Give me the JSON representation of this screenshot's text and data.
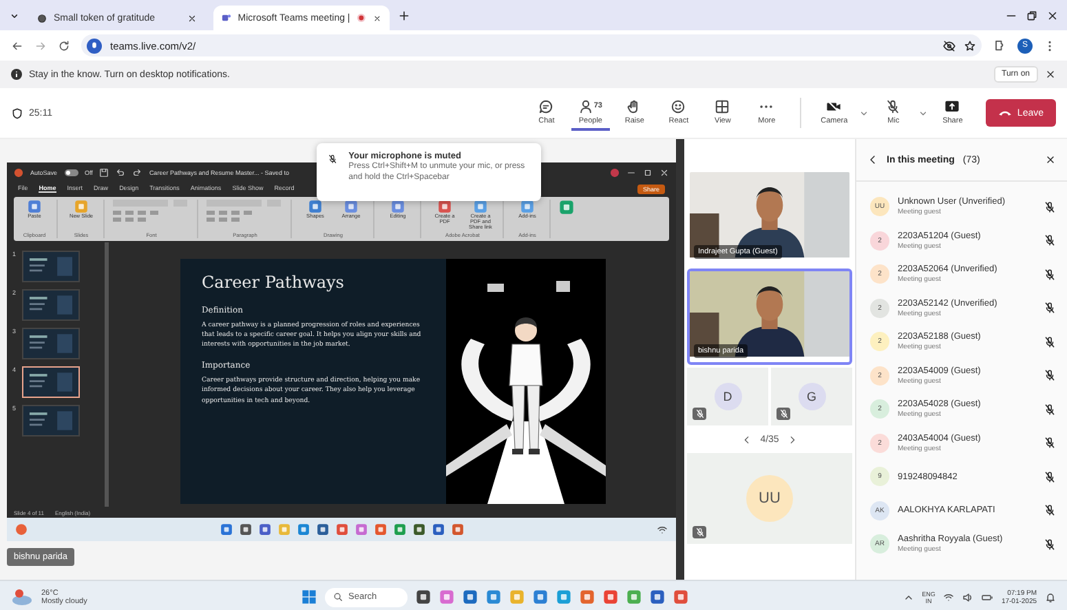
{
  "browser": {
    "tabs": [
      {
        "title": "Small token of gratitude",
        "selected": false
      },
      {
        "title": "Microsoft Teams meeting |",
        "selected": true
      }
    ],
    "url": "teams.live.com/v2/",
    "profile": "S"
  },
  "notification": {
    "text": "Stay in the know. Turn on desktop notifications.",
    "button": "Turn on"
  },
  "meeting": {
    "timer": "25:11",
    "toolbar": [
      {
        "kind": "chat",
        "label": "Chat",
        "selected": false
      },
      {
        "kind": "people",
        "label": "People",
        "count": "73",
        "selected": true
      },
      {
        "kind": "raise",
        "label": "Raise",
        "selected": false
      },
      {
        "kind": "react",
        "label": "React",
        "selected": false
      },
      {
        "kind": "view",
        "label": "View",
        "selected": false
      },
      {
        "kind": "more",
        "label": "More",
        "selected": false
      }
    ],
    "devices": [
      {
        "kind": "camera",
        "label": "Camera"
      },
      {
        "kind": "mic",
        "label": "Mic"
      },
      {
        "kind": "share",
        "label": "Share"
      }
    ],
    "leave": "Leave"
  },
  "toast": {
    "title": "Your microphone is muted",
    "text": "Press Ctrl+Shift+M to unmute your mic, or press and hold the Ctrl+Spacebar"
  },
  "shared_screen": {
    "ppt": {
      "autosave": "AutoSave",
      "autosave_on": false,
      "autosave_state": "Off",
      "title": "Career Pathways and Resume Master... - Saved to",
      "share": "Share",
      "ribbon_tabs": [
        {
          "label": "File",
          "selected": false
        },
        {
          "label": "Home",
          "selected": true
        },
        {
          "label": "Insert",
          "selected": false
        },
        {
          "label": "Draw",
          "selected": false
        },
        {
          "label": "Design",
          "selected": false
        },
        {
          "label": "Transitions",
          "selected": false
        },
        {
          "label": "Animations",
          "selected": false
        },
        {
          "label": "Slide Show",
          "selected": false
        },
        {
          "label": "Record",
          "selected": false
        }
      ],
      "ribbon_groups": [
        {
          "label": "Clipboard",
          "buttons": [
            "Paste"
          ]
        },
        {
          "label": "Slides",
          "buttons": [
            "New Slide"
          ]
        },
        {
          "label": "Font"
        },
        {
          "label": "Paragraph"
        },
        {
          "label": "Drawing",
          "buttons": [
            "Shapes",
            "Arrange"
          ]
        },
        {
          "buttons": [
            "Editing"
          ]
        },
        {
          "label": "Adobe Acrobat",
          "buttons": [
            "Create a PDF",
            "Create a PDF and Share link"
          ]
        },
        {
          "label": "Add-ins",
          "buttons": [
            "Add-ins"
          ]
        }
      ],
      "thumbnails": [
        {
          "number": "1",
          "selected": false
        },
        {
          "number": "2",
          "selected": false
        },
        {
          "number": "3",
          "selected": false
        },
        {
          "number": "4",
          "selected": true
        },
        {
          "number": "5",
          "selected": false
        }
      ],
      "slide": {
        "title": "Career Pathways",
        "sections": [
          {
            "heading": "Definition",
            "text": "A career pathway is a planned progression of roles and experiences that leads to a specific career goal. It helps you align your skills and interests with opportunities in the job market."
          },
          {
            "heading": "Importance",
            "text": "Career pathways provide structure and direction, helping you make informed decisions about your career. They also help you leverage opportunities in tech and beyond."
          }
        ]
      },
      "status": [
        "Slide 4 of 11",
        "English (India)"
      ]
    },
    "presenter": "bishnu parida"
  },
  "videos": [
    {
      "name": "Indrajeet Gupta (Guest)",
      "selected": false
    },
    {
      "name": "bishnu parida",
      "selected": true
    }
  ],
  "avatar_tiles": [
    {
      "initials": "D"
    },
    {
      "initials": "G"
    }
  ],
  "pager": "4/35",
  "large_tile": {
    "initials": "UU"
  },
  "people_panel": {
    "title": "In this meeting",
    "count": "(73)",
    "participants": [
      {
        "initials": "UU",
        "name": "Unknown User (Unverified)",
        "role": "Meeting guest",
        "color": "#fce6bd"
      },
      {
        "initials": "2",
        "name": "2203A51204 (Guest)",
        "role": "Meeting guest",
        "color": "#f9d6da"
      },
      {
        "initials": "2",
        "name": "2203A52064 (Unverified)",
        "role": "Meeting guest",
        "color": "#fde3c9"
      },
      {
        "initials": "2",
        "name": "2203A52142 (Unverified)",
        "role": "Meeting guest",
        "color": "#e2e4e1"
      },
      {
        "initials": "2",
        "name": "2203A52188 (Guest)",
        "role": "Meeting guest",
        "color": "#fdf0bf"
      },
      {
        "initials": "2",
        "name": "2203A54009 (Guest)",
        "role": "Meeting guest",
        "color": "#fde3c9"
      },
      {
        "initials": "2",
        "name": "2203A54028 (Guest)",
        "role": "Meeting guest",
        "color": "#d8eedd"
      },
      {
        "initials": "2",
        "name": "2403A54004 (Guest)",
        "role": "Meeting guest",
        "color": "#fbdcd9"
      },
      {
        "initials": "9",
        "name": "919248094842",
        "color": "#e9f1d9"
      },
      {
        "initials": "AK",
        "name": "AALOKHYA KARLAPATI",
        "color": "#dde6f3"
      },
      {
        "initials": "AR",
        "name": "Aashritha Royyala (Guest)",
        "role": "Meeting guest",
        "color": "#d8eedd"
      }
    ]
  },
  "taskbar": {
    "temperature": "26°C",
    "weather": "Mostly cloudy",
    "search": "Search",
    "language": "ENG",
    "region": "IN",
    "time": "07:19 PM",
    "date": "17-01-2025"
  }
}
